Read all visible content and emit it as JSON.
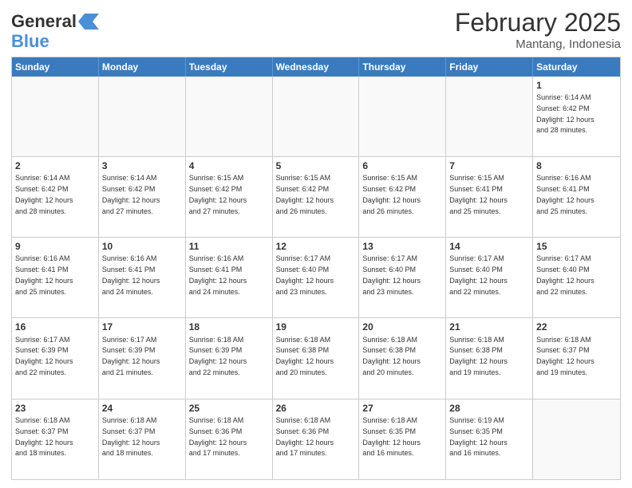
{
  "header": {
    "logo_line1": "General",
    "logo_line2": "Blue",
    "month_title": "February 2025",
    "location": "Mantang, Indonesia"
  },
  "days_of_week": [
    "Sunday",
    "Monday",
    "Tuesday",
    "Wednesday",
    "Thursday",
    "Friday",
    "Saturday"
  ],
  "weeks": [
    [
      {
        "day": "",
        "info": ""
      },
      {
        "day": "",
        "info": ""
      },
      {
        "day": "",
        "info": ""
      },
      {
        "day": "",
        "info": ""
      },
      {
        "day": "",
        "info": ""
      },
      {
        "day": "",
        "info": ""
      },
      {
        "day": "1",
        "info": "Sunrise: 6:14 AM\nSunset: 6:42 PM\nDaylight: 12 hours\nand 28 minutes."
      }
    ],
    [
      {
        "day": "2",
        "info": "Sunrise: 6:14 AM\nSunset: 6:42 PM\nDaylight: 12 hours\nand 28 minutes."
      },
      {
        "day": "3",
        "info": "Sunrise: 6:14 AM\nSunset: 6:42 PM\nDaylight: 12 hours\nand 27 minutes."
      },
      {
        "day": "4",
        "info": "Sunrise: 6:15 AM\nSunset: 6:42 PM\nDaylight: 12 hours\nand 27 minutes."
      },
      {
        "day": "5",
        "info": "Sunrise: 6:15 AM\nSunset: 6:42 PM\nDaylight: 12 hours\nand 26 minutes."
      },
      {
        "day": "6",
        "info": "Sunrise: 6:15 AM\nSunset: 6:42 PM\nDaylight: 12 hours\nand 26 minutes."
      },
      {
        "day": "7",
        "info": "Sunrise: 6:15 AM\nSunset: 6:41 PM\nDaylight: 12 hours\nand 25 minutes."
      },
      {
        "day": "8",
        "info": "Sunrise: 6:16 AM\nSunset: 6:41 PM\nDaylight: 12 hours\nand 25 minutes."
      }
    ],
    [
      {
        "day": "9",
        "info": "Sunrise: 6:16 AM\nSunset: 6:41 PM\nDaylight: 12 hours\nand 25 minutes."
      },
      {
        "day": "10",
        "info": "Sunrise: 6:16 AM\nSunset: 6:41 PM\nDaylight: 12 hours\nand 24 minutes."
      },
      {
        "day": "11",
        "info": "Sunrise: 6:16 AM\nSunset: 6:41 PM\nDaylight: 12 hours\nand 24 minutes."
      },
      {
        "day": "12",
        "info": "Sunrise: 6:17 AM\nSunset: 6:40 PM\nDaylight: 12 hours\nand 23 minutes."
      },
      {
        "day": "13",
        "info": "Sunrise: 6:17 AM\nSunset: 6:40 PM\nDaylight: 12 hours\nand 23 minutes."
      },
      {
        "day": "14",
        "info": "Sunrise: 6:17 AM\nSunset: 6:40 PM\nDaylight: 12 hours\nand 22 minutes."
      },
      {
        "day": "15",
        "info": "Sunrise: 6:17 AM\nSunset: 6:40 PM\nDaylight: 12 hours\nand 22 minutes."
      }
    ],
    [
      {
        "day": "16",
        "info": "Sunrise: 6:17 AM\nSunset: 6:39 PM\nDaylight: 12 hours\nand 22 minutes."
      },
      {
        "day": "17",
        "info": "Sunrise: 6:17 AM\nSunset: 6:39 PM\nDaylight: 12 hours\nand 21 minutes."
      },
      {
        "day": "18",
        "info": "Sunrise: 6:18 AM\nSunset: 6:39 PM\nDaylight: 12 hours\nand 22 minutes."
      },
      {
        "day": "19",
        "info": "Sunrise: 6:18 AM\nSunset: 6:38 PM\nDaylight: 12 hours\nand 20 minutes."
      },
      {
        "day": "20",
        "info": "Sunrise: 6:18 AM\nSunset: 6:38 PM\nDaylight: 12 hours\nand 20 minutes."
      },
      {
        "day": "21",
        "info": "Sunrise: 6:18 AM\nSunset: 6:38 PM\nDaylight: 12 hours\nand 19 minutes."
      },
      {
        "day": "22",
        "info": "Sunrise: 6:18 AM\nSunset: 6:37 PM\nDaylight: 12 hours\nand 19 minutes."
      }
    ],
    [
      {
        "day": "23",
        "info": "Sunrise: 6:18 AM\nSunset: 6:37 PM\nDaylight: 12 hours\nand 18 minutes."
      },
      {
        "day": "24",
        "info": "Sunrise: 6:18 AM\nSunset: 6:37 PM\nDaylight: 12 hours\nand 18 minutes."
      },
      {
        "day": "25",
        "info": "Sunrise: 6:18 AM\nSunset: 6:36 PM\nDaylight: 12 hours\nand 17 minutes."
      },
      {
        "day": "26",
        "info": "Sunrise: 6:18 AM\nSunset: 6:36 PM\nDaylight: 12 hours\nand 17 minutes."
      },
      {
        "day": "27",
        "info": "Sunrise: 6:18 AM\nSunset: 6:35 PM\nDaylight: 12 hours\nand 16 minutes."
      },
      {
        "day": "28",
        "info": "Sunrise: 6:19 AM\nSunset: 6:35 PM\nDaylight: 12 hours\nand 16 minutes."
      },
      {
        "day": "",
        "info": ""
      }
    ]
  ]
}
